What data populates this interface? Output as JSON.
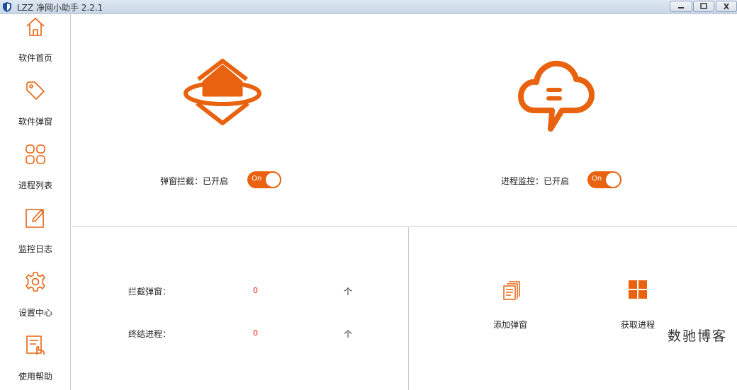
{
  "window": {
    "title": "LZZ 净网小助手 2.2.1"
  },
  "sidebar": {
    "items": [
      {
        "label": "软件首页",
        "icon": "home-icon"
      },
      {
        "label": "软件弹窗",
        "icon": "tag-icon"
      },
      {
        "label": "进程列表",
        "icon": "grid-icon"
      },
      {
        "label": "监控日志",
        "icon": "edit-icon"
      },
      {
        "label": "设置中心",
        "icon": "gear-icon"
      },
      {
        "label": "使用帮助",
        "icon": "help-doc-icon"
      }
    ]
  },
  "status": {
    "popup_block": {
      "label": "弹窗拦截：已开启",
      "toggle_text": "On",
      "enabled": true
    },
    "process_monitor": {
      "label": "进程监控：已开启",
      "toggle_text": "On",
      "enabled": true
    }
  },
  "stats": {
    "blocked_popups": {
      "label": "拦截弹窗：",
      "value": "0",
      "unit": "个"
    },
    "killed_processes": {
      "label": "终结进程：",
      "value": "0",
      "unit": "个"
    }
  },
  "actions": {
    "add_popup": {
      "label": "添加弹窗"
    },
    "get_process": {
      "label": "获取进程"
    }
  },
  "watermark": "数驰博客",
  "colors": {
    "accent": "#e8620f",
    "value_red": "#e02020"
  }
}
